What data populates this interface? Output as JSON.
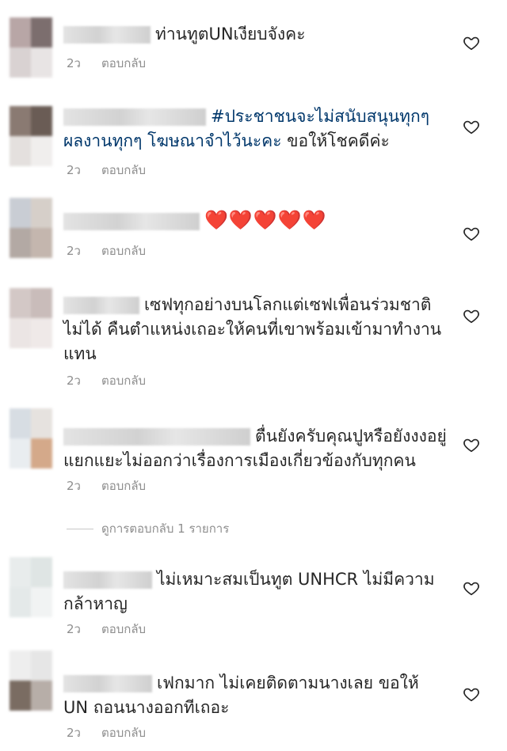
{
  "comments": [
    {
      "text": "ท่านทูตUNเงียบจังคะ",
      "time": "2ว",
      "reply_label": "ตอบกลับ"
    },
    {
      "tag": "#ประชาชนจะไม่สนับสนุนทุกๆผลงานทุกๆ โฆษณาจำไว้นะคะ",
      "text": " ขอให้โชคดีค่ะ",
      "time": "2ว",
      "reply_label": "ตอบกลับ"
    },
    {
      "text": "❤️❤️❤️❤️❤️",
      "time": "2ว",
      "reply_label": "ตอบกลับ"
    },
    {
      "text": "เซฟทุกอย่างบนโลกแต่เซฟเพื่อนร่วมชาติไม่ได้ คืนตำแหน่งเถอะให้คนที่เขาพร้อมเข้ามาทำงานแทน",
      "time": "2ว",
      "reply_label": "ตอบกลับ"
    },
    {
      "text": "ตื่นยังครับคุณปูหรือยังงงอยู่แยกแยะไม่ออกว่าเรื่องการเมืองเกี่ยวข้องกับทุกคน",
      "time": "2ว",
      "reply_label": "ตอบกลับ"
    },
    {
      "text": "ไม่เหมาะสมเป็นทูต UNHCR ไม่มีความกล้าหาญ",
      "time": "2ว",
      "reply_label": "ตอบกลับ"
    },
    {
      "text": "เฟกมาก ไม่เคยติดตามนางเลย ขอให้ UN ถอนนางออกทีเถอะ",
      "time": "2ว",
      "reply_label": "ตอบกลับ"
    }
  ],
  "view_replies_label": "ดูการตอบกลับ 1 รายการ",
  "icons": {
    "like": "heart-outline-icon"
  },
  "colors": {
    "hashtag": "#00376b",
    "meta": "#8e8e8e",
    "heart_emoji": "#e0202a"
  }
}
